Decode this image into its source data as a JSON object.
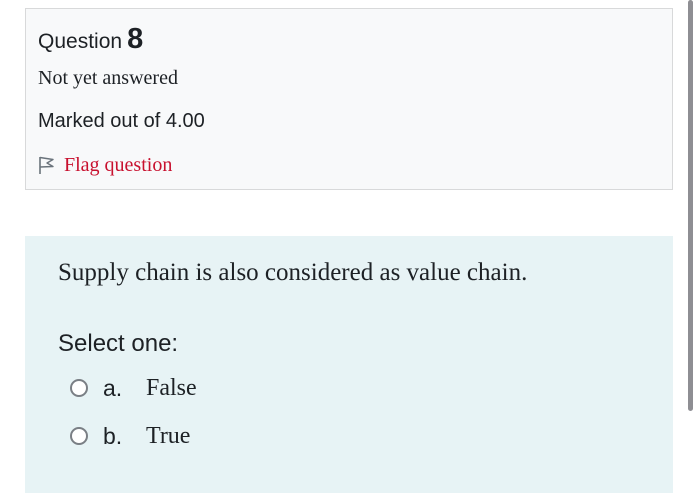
{
  "info": {
    "question_label": "Question",
    "question_number": "8",
    "state": "Not yet answered",
    "grade": "Marked out of 4.00",
    "flag_label": "Flag question",
    "flag_icon": "flag-outline-icon"
  },
  "question": {
    "text": "Supply chain is also considered as value chain.",
    "prompt": "Select one:",
    "answers": [
      {
        "letter": "a.",
        "text": "False",
        "selected": false
      },
      {
        "letter": "b.",
        "text": "True",
        "selected": false
      }
    ]
  },
  "colors": {
    "info_background": "#f8f9fa",
    "content_background": "#e7f3f5",
    "flag_text": "#c8102e",
    "radio_border": "#7a7f85"
  }
}
